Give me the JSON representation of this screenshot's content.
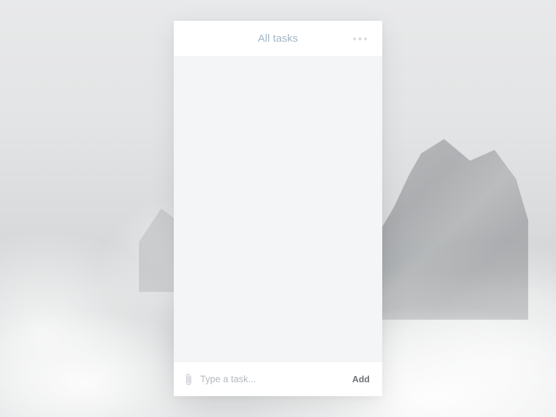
{
  "header": {
    "title": "All tasks"
  },
  "footer": {
    "placeholder": "Type a task...",
    "input_value": "",
    "add_label": "Add"
  },
  "icons": {
    "more": "more-horizontal-icon",
    "attach": "paperclip-icon"
  },
  "colors": {
    "title": "#9fb4c4",
    "task_area_bg": "#f4f5f6",
    "dots": "#d6d9dc",
    "placeholder": "#b4b9bd",
    "add": "#6e7478"
  }
}
